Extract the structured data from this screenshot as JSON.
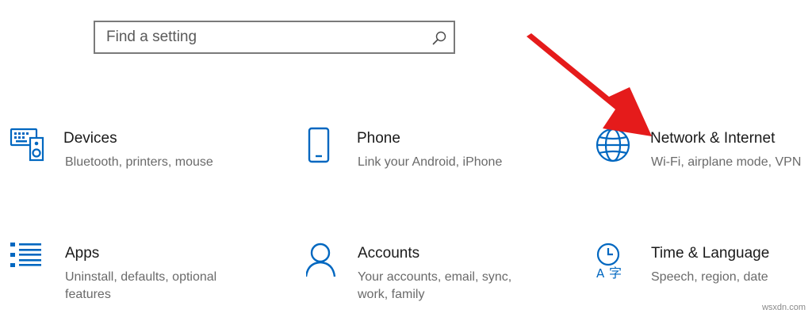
{
  "search": {
    "placeholder": "Find a setting"
  },
  "accent_color": "#0067c0",
  "arrow_color": "#e51b1b",
  "tiles": [
    {
      "title": "Devices",
      "description": "Bluetooth, printers, mouse",
      "icon": "devices-icon"
    },
    {
      "title": "Phone",
      "description": "Link your Android, iPhone",
      "icon": "phone-icon"
    },
    {
      "title": "Network & Internet",
      "description": "Wi-Fi, airplane mode, VPN",
      "icon": "globe-icon"
    },
    {
      "title": "Apps",
      "description": "Uninstall, defaults, optional features",
      "icon": "apps-list-icon"
    },
    {
      "title": "Accounts",
      "description": "Your accounts, email, sync, work, family",
      "icon": "person-icon"
    },
    {
      "title": "Time & Language",
      "description": "Speech, region, date",
      "icon": "time-language-icon"
    }
  ],
  "watermark": "wsxdn.com"
}
